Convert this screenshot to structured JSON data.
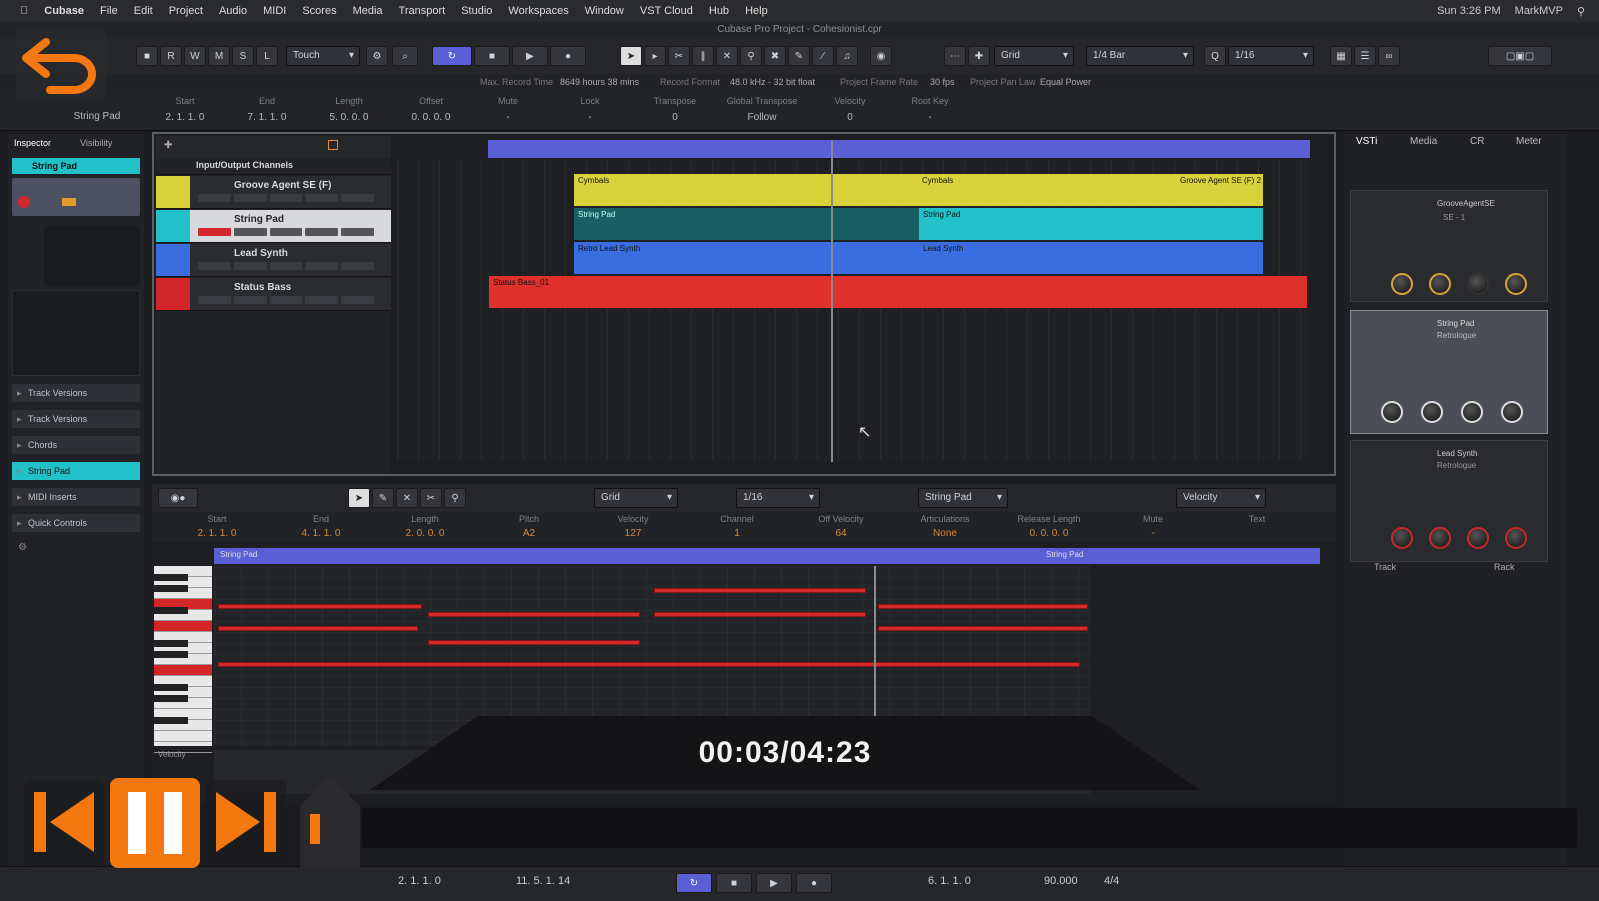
{
  "menubar": {
    "apple": "",
    "app": "Cubase",
    "items": [
      "File",
      "Edit",
      "Project",
      "Audio",
      "MIDI",
      "Scores",
      "Media",
      "Transport",
      "Studio",
      "Workspaces",
      "Window",
      "VST Cloud",
      "Hub",
      "Help"
    ],
    "clock": "Sun 3:26 PM",
    "user": "MarkMVP"
  },
  "titlebar": {
    "title": "Cubase Pro Project - Cohesionist.cpr"
  },
  "toolbar": {
    "automation_mode": "Touch",
    "snap_type": "Grid",
    "grid_value": "1/4 Bar",
    "quantize": "1/16"
  },
  "statusline": [
    "Max. Record Time",
    "8649 hours 38 mins",
    "Record Format",
    "48.0 kHz - 32 bit float",
    "Project Frame Rate",
    "30 fps",
    "Project Pan Law",
    "Equal Power"
  ],
  "infoline": {
    "selected_name": "String Pad",
    "columns": [
      {
        "label": "Start",
        "value": "2. 1. 1. 0"
      },
      {
        "label": "End",
        "value": "7. 1. 1. 0"
      },
      {
        "label": "Length",
        "value": "5. 0. 0. 0"
      },
      {
        "label": "Offset",
        "value": "0. 0. 0. 0"
      },
      {
        "label": "Mute",
        "value": "-"
      },
      {
        "label": "Lock",
        "value": "-"
      },
      {
        "label": "Transpose",
        "value": "0"
      },
      {
        "label": "Global Transpose",
        "value": "Follow"
      },
      {
        "label": "Velocity",
        "value": "0"
      },
      {
        "label": "Root Key",
        "value": "-"
      }
    ]
  },
  "inspector": {
    "tabs": [
      "Inspector",
      "Visibility"
    ],
    "track_name": "String Pad",
    "sections": [
      "Track Versions",
      "Chords",
      "String Pad",
      "MIDI Inserts",
      "Quick Controls"
    ]
  },
  "tracks": [
    {
      "name": "Input/Output Channels",
      "color": "#2a2c30"
    },
    {
      "name": "Groove Agent SE (F)",
      "color": "#d7d23a"
    },
    {
      "name": "String Pad",
      "color": "#22c0c8"
    },
    {
      "name": "Lead Synth",
      "color": "#3a6ee0"
    },
    {
      "name": "Status Bass",
      "color": "#d3262a"
    }
  ],
  "events": {
    "drums_a": "Cymbals",
    "drums_b": "Cymbals",
    "drums_c": "Groove Agent SE (F) 2",
    "pad_a": "String Pad",
    "pad_b": "String Pad",
    "lead_a": "Retro Lead Synth",
    "lead_b": "Lead Synth",
    "bass": "Status Bass_01"
  },
  "keyeditor": {
    "snap": "Grid",
    "quantize": "1/16",
    "part": "String Pad",
    "part_label_left": "String Pad",
    "part_label_right": "String Pad",
    "velocity_label": "Velocity",
    "fields": [
      {
        "label": "Start",
        "value": "2. 1. 1. 0"
      },
      {
        "label": "End",
        "value": "4. 1. 1. 0"
      },
      {
        "label": "Length",
        "value": "2. 0. 0. 0"
      },
      {
        "label": "Pitch",
        "value": "A2"
      },
      {
        "label": "Velocity",
        "value": "127"
      },
      {
        "label": "Channel",
        "value": "1"
      },
      {
        "label": "Off Velocity",
        "value": "64"
      },
      {
        "label": "Articulations",
        "value": "None"
      },
      {
        "label": "Release Length",
        "value": "0. 0. 0. 0"
      },
      {
        "label": "Mute",
        "value": "-"
      },
      {
        "label": "Text",
        "value": ""
      }
    ]
  },
  "rightpanel": {
    "tabs": [
      "VSTi",
      "Media",
      "CR",
      "Meter"
    ],
    "slots": [
      {
        "name": "GrooveAgentSE",
        "preset": "SE - 1"
      },
      {
        "name": "String Pad",
        "preset": "Retrologue"
      },
      {
        "name": "Lead Synth",
        "preset": "Retrologue"
      }
    ],
    "bottom_left": "Track",
    "bottom_right": "Rack"
  },
  "transport": {
    "left_locator": "2. 1. 1. 0",
    "right_locator": "11. 5. 1. 14",
    "position": "6. 1. 1. 0",
    "tempo": "90.000",
    "signature": "4/4"
  },
  "player": {
    "timecode": "00:03/04:23",
    "accent": "#f2780f"
  }
}
